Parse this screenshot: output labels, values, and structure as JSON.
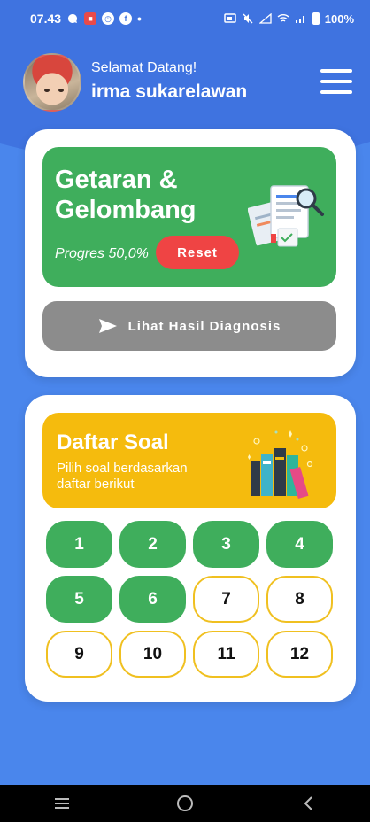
{
  "status_bar": {
    "time": "07.43",
    "dot": "•",
    "battery": "100%"
  },
  "header": {
    "greeting": "Selamat Datang!",
    "username": "irma sukarelawan"
  },
  "topic": {
    "title": "Getaran & Gelombang",
    "progress_label": "Progres 50,0%",
    "progress_fraction": 0.5,
    "reset_label": "Reset"
  },
  "diagnosis": {
    "label": "Lihat Hasil Diagnosis"
  },
  "soal": {
    "title": "Daftar Soal",
    "subtitle": "Pilih soal berdasarkan daftar berikut",
    "items": [
      {
        "label": "1",
        "done": true
      },
      {
        "label": "2",
        "done": true
      },
      {
        "label": "3",
        "done": true
      },
      {
        "label": "4",
        "done": true
      },
      {
        "label": "5",
        "done": true
      },
      {
        "label": "6",
        "done": true
      },
      {
        "label": "7",
        "done": false
      },
      {
        "label": "8",
        "done": false
      },
      {
        "label": "9",
        "done": false
      },
      {
        "label": "10",
        "done": false
      },
      {
        "label": "11",
        "done": false
      },
      {
        "label": "12",
        "done": false
      }
    ]
  },
  "colors": {
    "background": "#4a86ec",
    "header": "#3f73e0",
    "topic_green": "#3fae5c",
    "reset_red": "#ef4444",
    "diagnosis_gray": "#8c8c8c",
    "soal_yellow": "#f5bb0d"
  },
  "icons": {
    "nav": [
      "recent-apps-icon",
      "home-icon",
      "back-icon"
    ],
    "diagnosis": "send-icon"
  }
}
